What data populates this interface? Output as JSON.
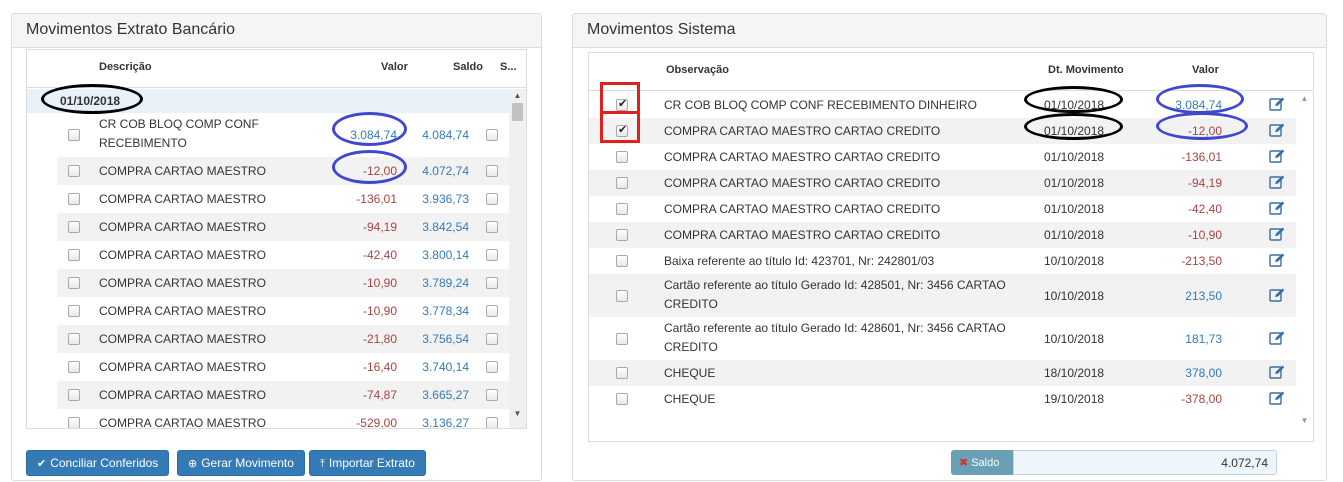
{
  "left_panel": {
    "title": "Movimentos Extrato Bancário",
    "columns": {
      "descricao": "Descrição",
      "valor": "Valor",
      "saldo": "Saldo",
      "s": "S..."
    },
    "group_date": "01/10/2018",
    "rows": [
      {
        "desc_line1": "CR COB BLOQ COMP CONF",
        "desc_line2": "RECEBIMENTO",
        "valor": "3.084,74",
        "saldo": "4.084,74"
      },
      {
        "desc_line1": "COMPRA CARTAO MAESTRO",
        "desc_line2": "",
        "valor": "-12,00",
        "saldo": "4.072,74"
      },
      {
        "desc_line1": "COMPRA CARTAO MAESTRO",
        "desc_line2": "",
        "valor": "-136,01",
        "saldo": "3.936,73"
      },
      {
        "desc_line1": "COMPRA CARTAO MAESTRO",
        "desc_line2": "",
        "valor": "-94,19",
        "saldo": "3.842,54"
      },
      {
        "desc_line1": "COMPRA CARTAO MAESTRO",
        "desc_line2": "",
        "valor": "-42,40",
        "saldo": "3.800,14"
      },
      {
        "desc_line1": "COMPRA CARTAO MAESTRO",
        "desc_line2": "",
        "valor": "-10,90",
        "saldo": "3.789,24"
      },
      {
        "desc_line1": "COMPRA CARTAO MAESTRO",
        "desc_line2": "",
        "valor": "-10,90",
        "saldo": "3.778,34"
      },
      {
        "desc_line1": "COMPRA CARTAO MAESTRO",
        "desc_line2": "",
        "valor": "-21,80",
        "saldo": "3.756,54"
      },
      {
        "desc_line1": "COMPRA CARTAO MAESTRO",
        "desc_line2": "",
        "valor": "-16,40",
        "saldo": "3.740,14"
      },
      {
        "desc_line1": "COMPRA CARTAO MAESTRO",
        "desc_line2": "",
        "valor": "-74,87",
        "saldo": "3.665,27"
      },
      {
        "desc_line1": "COMPRA CARTAO MAESTRO",
        "desc_line2": "",
        "valor": "-529,00",
        "saldo": "3.136,27"
      }
    ],
    "buttons": {
      "conciliar": "Conciliar Conferidos",
      "gerar": "Gerar Movimento",
      "importar": "Importar Extrato"
    }
  },
  "right_panel": {
    "title": "Movimentos Sistema",
    "columns": {
      "observacao": "Observação",
      "dt_movimento": "Dt. Movimento",
      "valor": "Valor"
    },
    "rows": [
      {
        "checked": true,
        "obs_line1": "CR COB BLOQ COMP CONF RECEBIMENTO DINHEIRO",
        "obs_line2": "",
        "data": "01/10/2018",
        "valor": "3.084,74"
      },
      {
        "checked": true,
        "obs_line1": "COMPRA CARTAO MAESTRO CARTAO CREDITO",
        "obs_line2": "",
        "data": "01/10/2018",
        "valor": "-12,00"
      },
      {
        "checked": false,
        "obs_line1": "COMPRA CARTAO MAESTRO CARTAO CREDITO",
        "obs_line2": "",
        "data": "01/10/2018",
        "valor": "-136,01"
      },
      {
        "checked": false,
        "obs_line1": "COMPRA CARTAO MAESTRO CARTAO CREDITO",
        "obs_line2": "",
        "data": "01/10/2018",
        "valor": "-94,19"
      },
      {
        "checked": false,
        "obs_line1": "COMPRA CARTAO MAESTRO CARTAO CREDITO",
        "obs_line2": "",
        "data": "01/10/2018",
        "valor": "-42,40"
      },
      {
        "checked": false,
        "obs_line1": "COMPRA CARTAO MAESTRO CARTAO CREDITO",
        "obs_line2": "",
        "data": "01/10/2018",
        "valor": "-10,90"
      },
      {
        "checked": false,
        "obs_line1": "Baixa referente ao título Id: 423701, Nr: 242801/03",
        "obs_line2": "",
        "data": "10/10/2018",
        "valor": "-213,50"
      },
      {
        "checked": false,
        "obs_line1": "Cartão referente ao título Gerado Id: 428501, Nr: 3456 CARTAO",
        "obs_line2": "CREDITO",
        "data": "10/10/2018",
        "valor": "213,50"
      },
      {
        "checked": false,
        "obs_line1": "Cartão referente ao título Gerado Id: 428601, Nr: 3456 CARTAO",
        "obs_line2": "CREDITO",
        "data": "10/10/2018",
        "valor": "181,73"
      },
      {
        "checked": false,
        "obs_line1": "CHEQUE",
        "obs_line2": "",
        "data": "18/10/2018",
        "valor": "378,00"
      },
      {
        "checked": false,
        "obs_line1": "CHEQUE",
        "obs_line2": "",
        "data": "19/10/2018",
        "valor": "-378,00"
      }
    ],
    "saldo_label": "Saldo",
    "saldo_value": "4.072,74"
  },
  "icons": {
    "check": "check-icon",
    "edit": "edit-icon",
    "upload": "upload-icon",
    "plus_circle": "plus-circle-icon",
    "close": "close-icon"
  },
  "colors": {
    "primary": "#337ab7",
    "negative": "#a94442",
    "annotation_blue": "#3f48cc",
    "annotation_red": "#e01f1f"
  }
}
